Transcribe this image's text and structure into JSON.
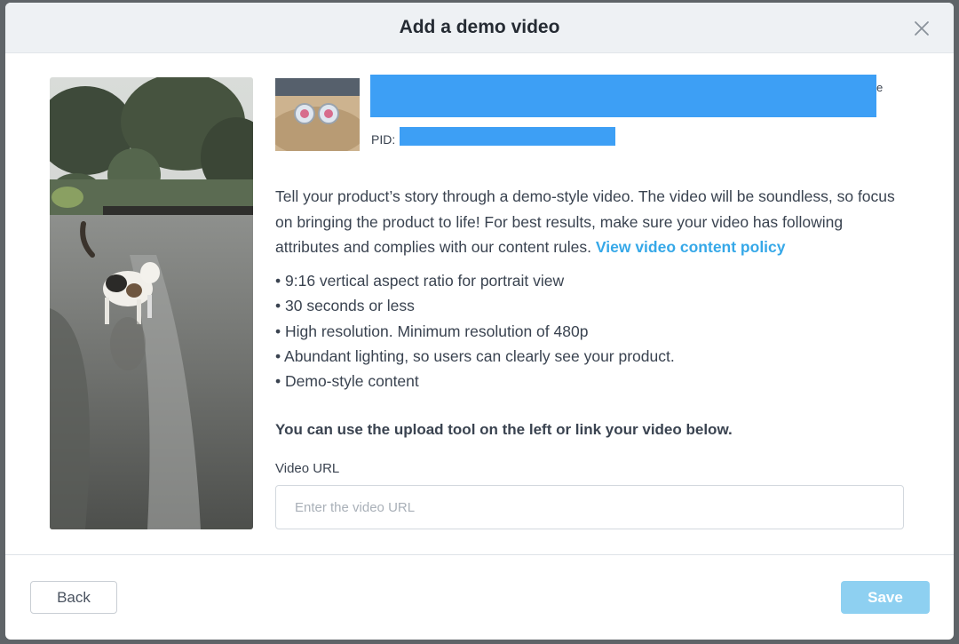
{
  "modal": {
    "title": "Add a demo video",
    "close_icon": "close-icon"
  },
  "product": {
    "thumbnail_icon": "product-thumbnail",
    "name_visible_suffix": "e",
    "pid_label": "PID:",
    "redaction_color": "#3d9ff5"
  },
  "intro": {
    "text": "Tell your product’s story through a demo-style video. The video will be soundless, so focus on bringing the product to life! For best results, make sure your video has following attributes and complies with our content rules.",
    "policy_link": "View video content policy"
  },
  "attributes": [
    "9:16 vertical aspect ratio for portrait view",
    "30 seconds or less",
    "High resolution. Minimum resolution of 480p",
    "Abundant lighting, so users can clearly see your product.",
    "Demo-style content"
  ],
  "upload_hint": "You can use the upload tool on the left or link your video below.",
  "video_url": {
    "label": "Video URL",
    "placeholder": "Enter the video URL",
    "value": ""
  },
  "footer": {
    "back_label": "Back",
    "save_label": "Save",
    "save_color": "#8ed0f1"
  },
  "colors": {
    "link": "#36a8e8",
    "header_bg": "#eef1f4",
    "text": "#3a4350"
  }
}
